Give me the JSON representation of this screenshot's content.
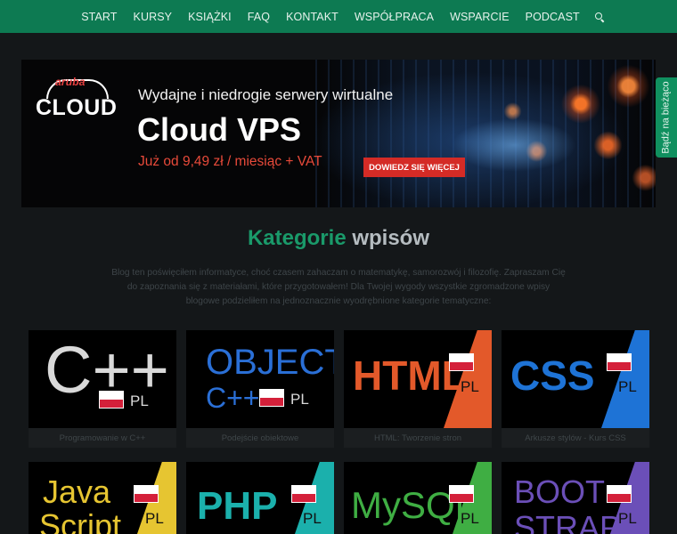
{
  "nav": {
    "items": [
      "START",
      "KURSY",
      "KSIĄŻKI",
      "FAQ",
      "KONTAKT",
      "WSPÓŁPRACA",
      "WSPARCIE",
      "PODCAST"
    ],
    "search_icon": "search-icon"
  },
  "side_tab": {
    "label": "Bądź na bieżąco"
  },
  "banner": {
    "logo_small": "aruba",
    "logo_big": "CLOUD",
    "subtitle": "Wydajne i niedrogie serwery wirtualne",
    "title": "Cloud VPS",
    "price": "Już od 9,49 zł / miesiąc + VAT",
    "cta": "DOWIEDZ SIĘ WIĘCEJ"
  },
  "categories": {
    "heading_accent": "Kategorie",
    "heading_rest": " wpisów",
    "intro": "Blog ten poświęciłem informatyce, choć czasem zahaczam o matematykę, samorozwój i filozofię. Zapraszam Cię do zapoznania się z materiałami, które przygotowałem! Dla Twojej wygody wszystkie zgromadzone wpisy blogowe podzieliłem na jednoznacznie wyodrębnione kategorie tematyczne:",
    "tiles": [
      {
        "logo": "C++",
        "pl": "PL",
        "caption": "Programowanie w C++",
        "color": "#d9d9d9"
      },
      {
        "logo_line1": "OBJECT",
        "logo_line2": "C++",
        "pl": "PL",
        "caption": "Podejście obiektowe",
        "color": "#2a6fd6"
      },
      {
        "logo": "HTML",
        "pl": "PL",
        "caption": "HTML: Tworzenie stron",
        "color": "#e3592a"
      },
      {
        "logo": "CSS",
        "pl": "PL",
        "caption": "Arkusze stylów - Kurs CSS",
        "color": "#1e73d6"
      },
      {
        "logo_line1": "Java",
        "logo_line2": "Script",
        "pl": "PL",
        "caption": "",
        "color": "#e6c531"
      },
      {
        "logo": "PHP",
        "pl": "PL",
        "caption": "",
        "color": "#1bb0ac"
      },
      {
        "logo": "MySQL",
        "pl": "PL",
        "caption": "",
        "color": "#3fae43"
      },
      {
        "logo_line1": "BOOT",
        "logo_line2": "STRAP",
        "pl": "PL",
        "caption": "",
        "color": "#6b4fb8"
      }
    ]
  }
}
